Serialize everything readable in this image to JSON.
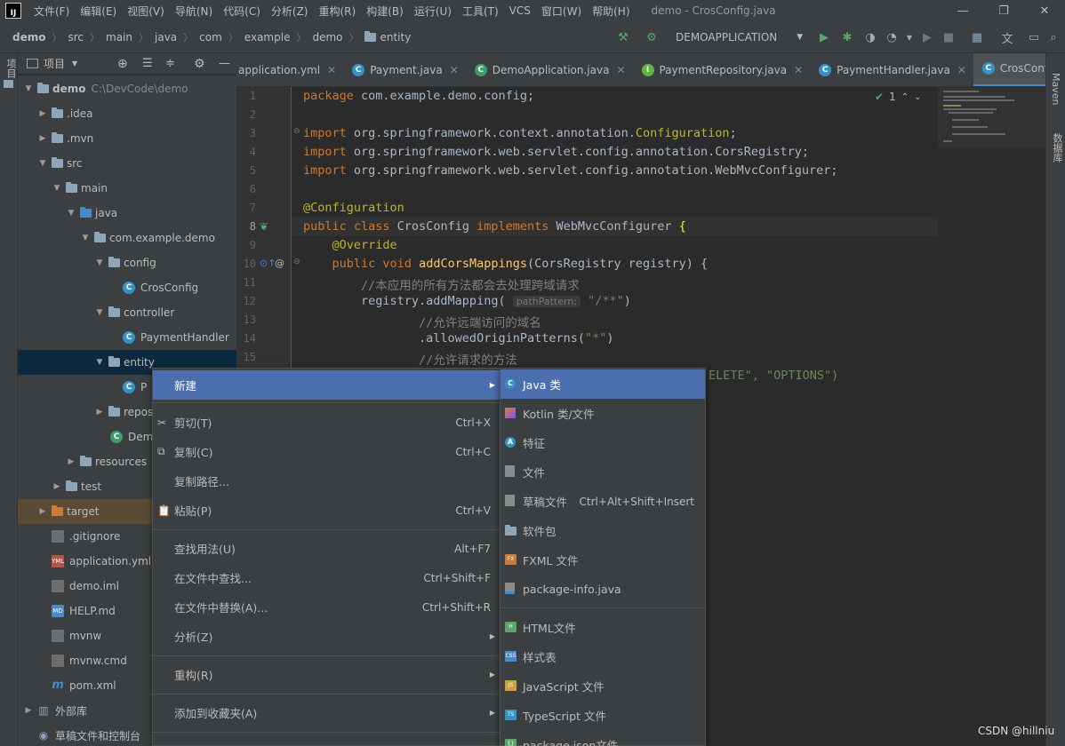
{
  "menubar": {
    "logo": "IJ",
    "items": [
      "文件(F)",
      "编辑(E)",
      "视图(V)",
      "导航(N)",
      "代码(C)",
      "分析(Z)",
      "重构(R)",
      "构建(B)",
      "运行(U)",
      "工具(T)",
      "VCS",
      "窗口(W)",
      "帮助(H)"
    ],
    "window_title": "demo - CrosConfig.java"
  },
  "breadcrumbs": [
    "demo",
    "src",
    "main",
    "java",
    "com",
    "example",
    "demo",
    "entity"
  ],
  "run_config": "DEMOAPPLICATION",
  "left_stripe": {
    "project": "项目"
  },
  "right_stripe": {
    "maven": "Maven",
    "database": "数据库"
  },
  "project_panel": {
    "title": "项目"
  },
  "tree": [
    {
      "label": "demo",
      "extra": "C:\\DevCode\\demo"
    },
    {
      "label": ".idea"
    },
    {
      "label": ".mvn"
    },
    {
      "label": "src"
    },
    {
      "label": "main"
    },
    {
      "label": "java"
    },
    {
      "label": "com.example.demo"
    },
    {
      "label": "config"
    },
    {
      "label": "CrosConfig"
    },
    {
      "label": "controller"
    },
    {
      "label": "PaymentHandler"
    },
    {
      "label": "entity"
    },
    {
      "label": "P"
    },
    {
      "label": "repos"
    },
    {
      "label": "Dem"
    },
    {
      "label": "resources"
    },
    {
      "label": "test"
    },
    {
      "label": "target"
    },
    {
      "label": ".gitignore"
    },
    {
      "label": "application.yml"
    },
    {
      "label": "demo.iml"
    },
    {
      "label": "HELP.md"
    },
    {
      "label": "mvnw"
    },
    {
      "label": "mvnw.cmd"
    },
    {
      "label": "pom.xml"
    },
    {
      "label": "外部库"
    },
    {
      "label": "草稿文件和控制台"
    }
  ],
  "tabs": [
    "application.yml",
    "Payment.java",
    "DemoApplication.java",
    "PaymentRepository.java",
    "PaymentHandler.java",
    "CrosConfig.java"
  ],
  "editor": {
    "line_numbers": [
      "1",
      "2",
      "3",
      "4",
      "5",
      "6",
      "7",
      "8",
      "9",
      "10",
      "11",
      "12",
      "13",
      "14",
      "15"
    ],
    "inspection_count": "1",
    "hint": "pathPattern:",
    "line15_tail": "ELETE\", \"OPTIONS\")"
  },
  "context_menu": [
    {
      "label": "新建",
      "shortcut": ""
    },
    {
      "label": "剪切(T)",
      "shortcut": "Ctrl+X"
    },
    {
      "label": "复制(C)",
      "shortcut": "Ctrl+C"
    },
    {
      "label": "复制路径...",
      "shortcut": ""
    },
    {
      "label": "粘贴(P)",
      "shortcut": "Ctrl+V"
    },
    {
      "label": "查找用法(U)",
      "shortcut": "Alt+F7"
    },
    {
      "label": "在文件中查找...",
      "shortcut": "Ctrl+Shift+F"
    },
    {
      "label": "在文件中替换(A)...",
      "shortcut": "Ctrl+Shift+R"
    },
    {
      "label": "分析(Z)",
      "shortcut": ""
    },
    {
      "label": "重构(R)",
      "shortcut": ""
    },
    {
      "label": "添加到收藏夹(A)",
      "shortcut": ""
    }
  ],
  "submenu": [
    {
      "label": "Java 类",
      "shortcut": ""
    },
    {
      "label": "Kotlin 类/文件",
      "shortcut": ""
    },
    {
      "label": "特征",
      "shortcut": ""
    },
    {
      "label": "文件",
      "shortcut": ""
    },
    {
      "label": "草稿文件",
      "shortcut": "Ctrl+Alt+Shift+Insert"
    },
    {
      "label": "软件包",
      "shortcut": ""
    },
    {
      "label": "FXML 文件",
      "shortcut": ""
    },
    {
      "label": "package-info.java",
      "shortcut": ""
    },
    {
      "label": "HTML文件",
      "shortcut": ""
    },
    {
      "label": "样式表",
      "shortcut": ""
    },
    {
      "label": "JavaScript 文件",
      "shortcut": ""
    },
    {
      "label": "TypeScript 文件",
      "shortcut": ""
    },
    {
      "label": "package.json文件",
      "shortcut": ""
    }
  ],
  "watermark": "CSDN @hillniu"
}
